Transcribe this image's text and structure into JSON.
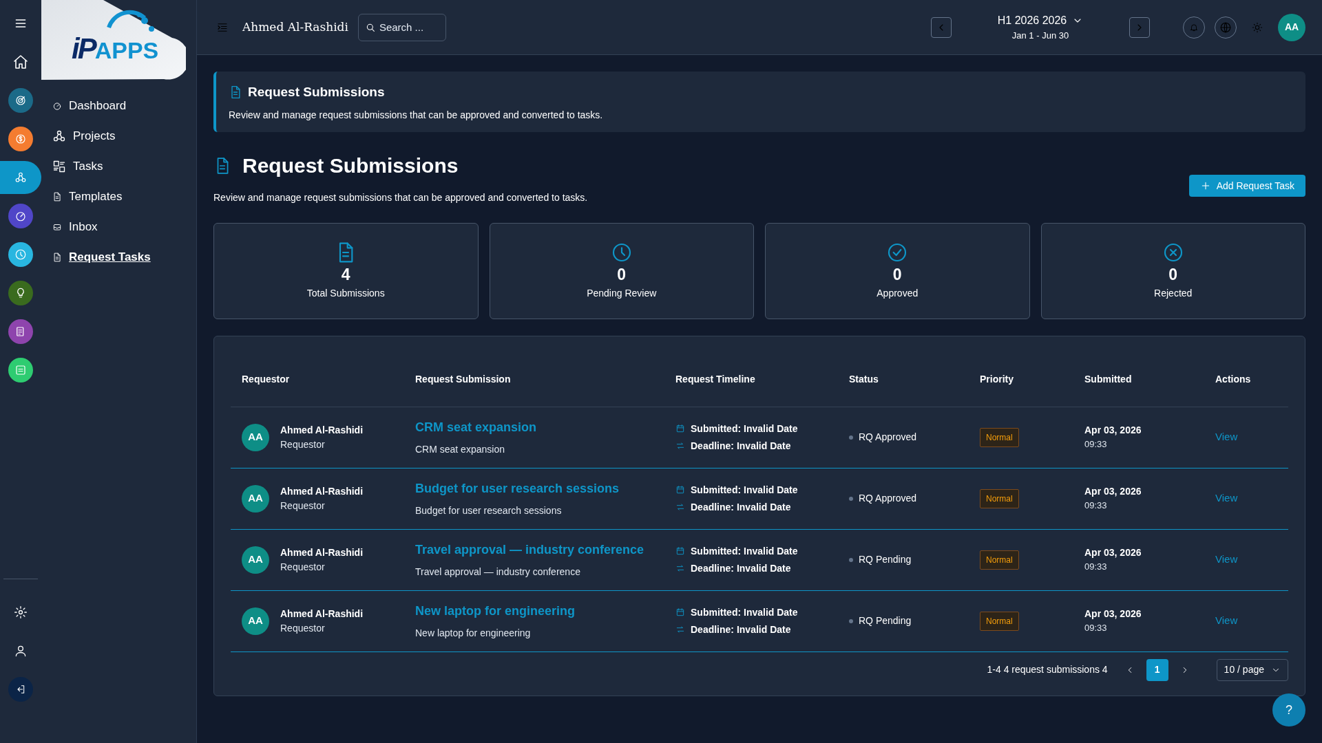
{
  "rail": {
    "items": [
      {
        "kind": "home",
        "selected": false
      },
      {
        "kind": "app",
        "color": "#1b6a88",
        "selected": false
      },
      {
        "kind": "app",
        "color": "#f47c30",
        "selected": false
      },
      {
        "kind": "app",
        "color": "#0e96c8",
        "selected": true
      },
      {
        "kind": "app",
        "color": "#5046c8",
        "selected": false
      },
      {
        "kind": "app",
        "color": "#29b6e0",
        "selected": false
      },
      {
        "kind": "app",
        "color": "#3a6b1e",
        "selected": false
      },
      {
        "kind": "app",
        "color": "#8e44ad",
        "selected": false
      },
      {
        "kind": "app",
        "color": "#2ecc71",
        "selected": false
      }
    ]
  },
  "logo": {
    "mark": "iP",
    "name": "APPS"
  },
  "nav": [
    {
      "label": "Dashboard",
      "selected": false
    },
    {
      "label": "Projects",
      "selected": false
    },
    {
      "label": "Tasks",
      "selected": false
    },
    {
      "label": "Templates",
      "selected": false
    },
    {
      "label": "Inbox",
      "selected": false
    },
    {
      "label": "Request Tasks",
      "selected": true
    }
  ],
  "topbar": {
    "user": "Ahmed Al-Rashidi",
    "search": {
      "placeholder": "Search ..."
    },
    "period": "H1 2026 2026",
    "range": "Jan 1 - Jun 30",
    "avatar": "AA"
  },
  "banner": {
    "title": "Request Submissions",
    "text": "Review and manage request submissions that can be approved and converted to tasks."
  },
  "page": {
    "title": "Request Submissions",
    "text": "Review and manage request submissions that can be approved and converted to tasks.",
    "add_button": "Add Request Task"
  },
  "stats": [
    {
      "kind": "file",
      "value": "4",
      "label": "Total Submissions"
    },
    {
      "kind": "clock",
      "value": "0",
      "label": "Pending Review"
    },
    {
      "kind": "check",
      "value": "0",
      "label": "Approved"
    },
    {
      "kind": "cross",
      "value": "0",
      "label": "Rejected"
    }
  ],
  "table": {
    "columns": [
      "Requestor",
      "Request Submission",
      "Request Timeline",
      "Status",
      "Priority",
      "Submitted",
      "Actions"
    ],
    "rows": [
      {
        "initials": "AA",
        "name": "Ahmed Al-Rashidi",
        "role": "Requestor",
        "title": "CRM seat expansion",
        "description": "CRM seat expansion",
        "submitted": "Submitted: Invalid Date",
        "deadline": "Deadline: Invalid Date",
        "status": "RQ Approved",
        "priority": "Normal",
        "date": "Apr 03, 2026",
        "time": "09:33",
        "action": "View"
      },
      {
        "initials": "AA",
        "name": "Ahmed Al-Rashidi",
        "role": "Requestor",
        "title": "Budget for user research sessions",
        "description": "Budget for user research sessions",
        "submitted": "Submitted: Invalid Date",
        "deadline": "Deadline: Invalid Date",
        "status": "RQ Approved",
        "priority": "Normal",
        "date": "Apr 03, 2026",
        "time": "09:33",
        "action": "View"
      },
      {
        "initials": "AA",
        "name": "Ahmed Al-Rashidi",
        "role": "Requestor",
        "title": "Travel approval — industry conference",
        "description": "Travel approval — industry conference",
        "submitted": "Submitted: Invalid Date",
        "deadline": "Deadline: Invalid Date",
        "status": "RQ Pending",
        "priority": "Normal",
        "date": "Apr 03, 2026",
        "time": "09:33",
        "action": "View"
      },
      {
        "initials": "AA",
        "name": "Ahmed Al-Rashidi",
        "role": "Requestor",
        "title": "New laptop for engineering",
        "description": "New laptop for engineering",
        "submitted": "Submitted: Invalid Date",
        "deadline": "Deadline: Invalid Date",
        "status": "RQ Pending",
        "priority": "Normal",
        "date": "Apr 03, 2026",
        "time": "09:33",
        "action": "View"
      }
    ]
  },
  "pagination": {
    "summary": "1-4 4 request submissions 4",
    "pages": [
      {
        "label": "1",
        "selected": true
      }
    ],
    "page_size": "10 / page"
  },
  "help": "?"
}
